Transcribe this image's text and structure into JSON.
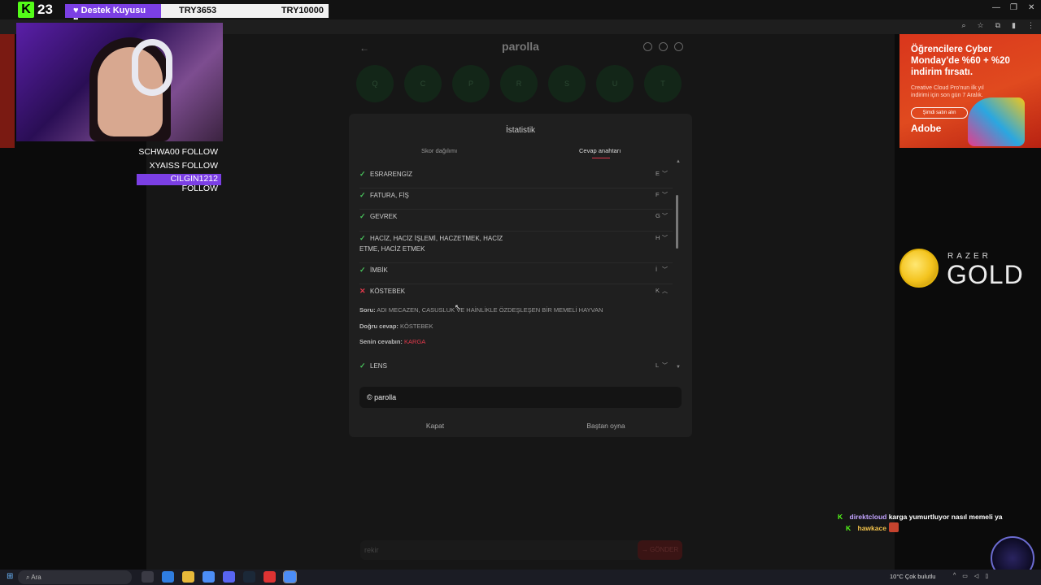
{
  "stream": {
    "kick_logo": "K",
    "viewer_count": "23",
    "support_label": "♥ Destek Kuyusu ♥",
    "goal_left": "TRY3653",
    "goal_right": "TRY10000"
  },
  "followers": [
    "SCHWA00  FOLLOW",
    "XYAISS  FOLLOW",
    "CILGIN1212  FOLLOW"
  ],
  "game": {
    "brand": "parolla",
    "circles": [
      "Q",
      "C",
      "P",
      "R",
      "S",
      "U",
      "T"
    ],
    "guess_placeholder": "rekir",
    "guess_button": "→ GÖNDER"
  },
  "modal": {
    "title": "İstatistik",
    "tabs": [
      "Skor dağılımı",
      "Cevap anahtarı"
    ],
    "rows": [
      {
        "status": "correct",
        "text": "ESRARENGİZ",
        "letter": "E"
      },
      {
        "status": "correct",
        "text": "FATURA, FİŞ",
        "letter": "F"
      },
      {
        "status": "correct",
        "text": "GEVREK",
        "letter": "G"
      },
      {
        "status": "correct",
        "text": "HACİZ, HACİZ İŞLEMİ, HACZETMEK, HACİZ",
        "text2": "ETME, HACİZ ETMEK",
        "letter": "H"
      },
      {
        "status": "correct",
        "text": "İMBİK",
        "letter": "İ"
      },
      {
        "status": "wrong",
        "text": "KÖSTEBEK",
        "letter": "K"
      },
      {
        "status": "correct",
        "text": "LENS",
        "letter": "L"
      }
    ],
    "detail": {
      "question_label": "Soru:",
      "question": "ADI MECAZEN, CASUSLUK VE HAİNLİKLE ÖZDEŞLEŞEN BİR MEMELİ HAYVAN",
      "answer_label": "Doğru cevap:",
      "answer": "KÖSTEBEK",
      "user_label": "Senin cevabın:",
      "user_answer": "KARGA"
    },
    "footer": "© parolla",
    "close_button": "Kapat",
    "replay_button": "Baştan oyna"
  },
  "ad": {
    "title": "Öğrencilere Cyber Monday'de %60 + %20 indirim fırsatı.",
    "body": "Creative Cloud Pro'nun ilk yıl indirimi için son gün 7 Aralık.",
    "button": "Şimdi satın alın",
    "brand": "Adobe"
  },
  "razer": {
    "small": "RAZER",
    "big": "GOLD"
  },
  "chat": [
    {
      "user": "direktcloud",
      "message": "karga yumurtluyor nasıl memeli ya"
    },
    {
      "user": "hawkace",
      "message": ""
    }
  ],
  "taskbar": {
    "search": "Ara",
    "weather": "10°C  Çok bulutlu"
  },
  "colors": {
    "kick": "#53fc18",
    "correct": "#47c05a",
    "wrong": "#e0394b",
    "accent": "#7b3fe4"
  }
}
